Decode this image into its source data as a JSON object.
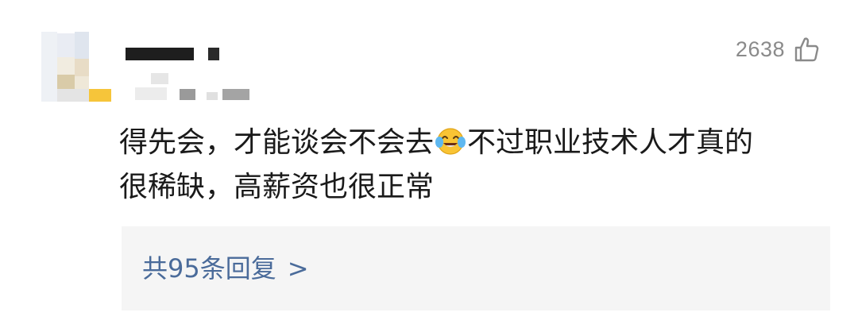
{
  "comment": {
    "likes": "2638",
    "like_icon": "thumbs-up-icon",
    "text_before_emoji": "得先会，才能谈会不会去",
    "emoji": "tears-of-joy-emoji",
    "text_after_emoji_line1": "不过职业技术人才真的",
    "text_line2": "很稀缺，高薪资也很正常",
    "replies_label": "共95条回复",
    "replies_chevron": ">"
  },
  "colors": {
    "like_count": "#8a8a8a",
    "body_text": "#1a1a1a",
    "replies_link": "#4a6b9a",
    "replies_bg": "#f5f5f5"
  }
}
